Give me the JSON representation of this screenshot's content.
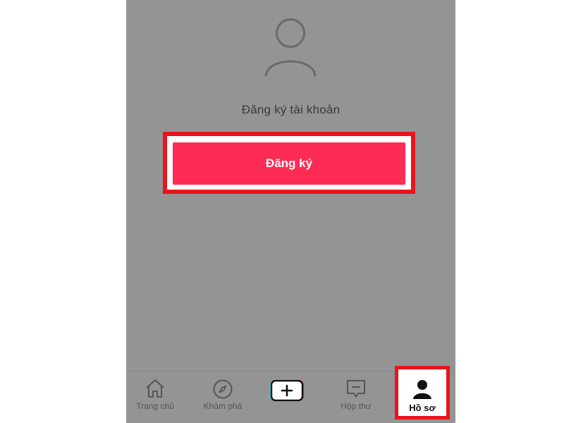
{
  "profile_screen": {
    "prompt": "Đăng ký tài khoản",
    "signup_label": "Đăng ký"
  },
  "tabbar": {
    "items": [
      {
        "label": "Trang chủ",
        "icon": "home-icon"
      },
      {
        "label": "Khám phá",
        "icon": "compass-icon"
      },
      {
        "label": "",
        "icon": "plus-icon"
      },
      {
        "label": "Hộp thư",
        "icon": "inbox-icon"
      },
      {
        "label": "Hồ sơ",
        "icon": "profile-icon"
      }
    ]
  },
  "colors": {
    "background": "#949494",
    "signup_button": "#fe2c55",
    "highlight": "#e8141d",
    "create_cyan": "#25f4ee",
    "create_red": "#fe2c55"
  }
}
